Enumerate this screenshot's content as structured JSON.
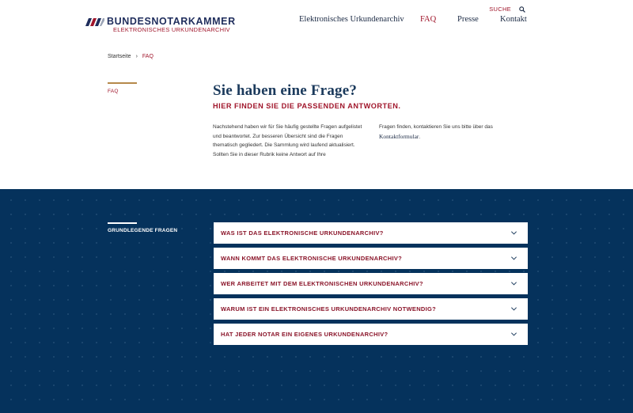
{
  "brand": {
    "title": "BUNDESNOTARKAMMER",
    "subtitle": "ELEKTRONISCHES URKUNDENARCHIV",
    "colors": {
      "navy": "#1f2d5c",
      "accent": "#a0162b",
      "gold": "#b5894a",
      "section_bg": "#05325c"
    }
  },
  "util": {
    "search_label": "SUCHE",
    "search_icon": "search-icon"
  },
  "nav": {
    "items": [
      {
        "label": "Elektronisches Urkundenarchiv"
      },
      {
        "label": "FAQ"
      },
      {
        "label": "Presse"
      },
      {
        "label": "Kontakt"
      }
    ]
  },
  "breadcrumb": {
    "home": "Startseite",
    "separator": "›",
    "current": "FAQ"
  },
  "intro": {
    "side_label": "FAQ",
    "title": "Sie haben eine Frage?",
    "subtitle": "HIER FINDEN SIE DIE PASSENDEN ANTWORTEN.",
    "col1": "Nachstehend haben wir für Sie häufig gestellte Fragen aufgelistet und beantwortet. Zur besseren Übersicht sind die Fragen thematisch gegliedert. Die Sammlung wird laufend aktualisiert. Sollten Sie in dieser Rubrik keine Antwort auf Ihre",
    "col2_text": "Fragen finden, kontaktieren Sie uns bitte über das",
    "col2_link": "Kontaktformular",
    "col2_end": "."
  },
  "faq": {
    "section_label": "GRUNDLEGENDE FRAGEN",
    "items": [
      {
        "question": "WAS IST DAS ELEKTRONISCHE URKUNDENARCHIV?"
      },
      {
        "question": "WANN KOMMT DAS ELEKTRONISCHE URKUNDENARCHIV?"
      },
      {
        "question": "WER ARBEITET MIT DEM ELEKTRONISCHEN URKUNDENARCHIV?"
      },
      {
        "question": "WARUM IST EIN ELEKTRONISCHES URKUNDENARCHIV NOTWENDIG?"
      },
      {
        "question": "HAT JEDER NOTAR EIN EIGENES URKUNDENARCHIV?"
      }
    ]
  }
}
